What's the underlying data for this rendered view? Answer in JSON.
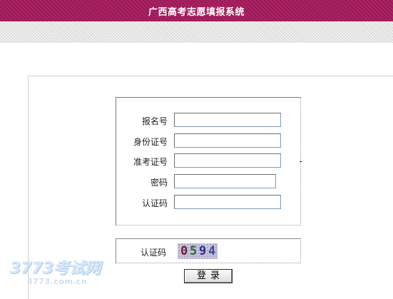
{
  "header": {
    "title": "广西高考志愿填报系统"
  },
  "form": {
    "fields": [
      {
        "label": "报名号",
        "value": ""
      },
      {
        "label": "身份证号",
        "value": ""
      },
      {
        "label": "准考证号",
        "value": ""
      },
      {
        "label": "密码",
        "value": ""
      },
      {
        "label": "认证码",
        "value": ""
      }
    ]
  },
  "captcha": {
    "label": "认证码",
    "code": [
      "0",
      "5",
      "9",
      "4"
    ],
    "digit_colors": [
      "#6b1f3a",
      "#2f6b3a",
      "#2a2f8a",
      "#3f4a8f"
    ]
  },
  "login": {
    "label": "登录"
  },
  "watermark": {
    "logo_text": "3773考试网",
    "url": "3773.com.cn"
  }
}
